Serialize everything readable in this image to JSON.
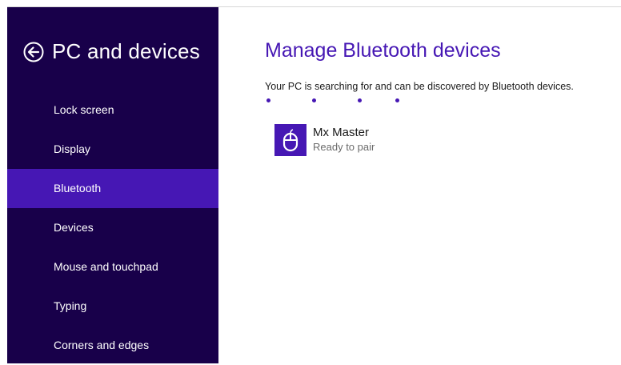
{
  "sidebar": {
    "title": "PC and devices",
    "back_icon": "back-arrow-circle-icon",
    "items": [
      {
        "label": "Lock screen",
        "active": false
      },
      {
        "label": "Display",
        "active": false
      },
      {
        "label": "Bluetooth",
        "active": true
      },
      {
        "label": "Devices",
        "active": false
      },
      {
        "label": "Mouse and touchpad",
        "active": false
      },
      {
        "label": "Typing",
        "active": false
      },
      {
        "label": "Corners and edges",
        "active": false
      }
    ]
  },
  "main": {
    "title": "Manage Bluetooth devices",
    "status": "Your PC is searching for and can be discovered by Bluetooth devices.",
    "devices": [
      {
        "name": "Mx Master",
        "status": "Ready to pair",
        "icon": "mouse-icon"
      }
    ]
  },
  "colors": {
    "sidebar_bg": "#18004a",
    "accent": "#4617b4",
    "text": "#1a1a1a",
    "muted_text": "#6b6b6b"
  }
}
